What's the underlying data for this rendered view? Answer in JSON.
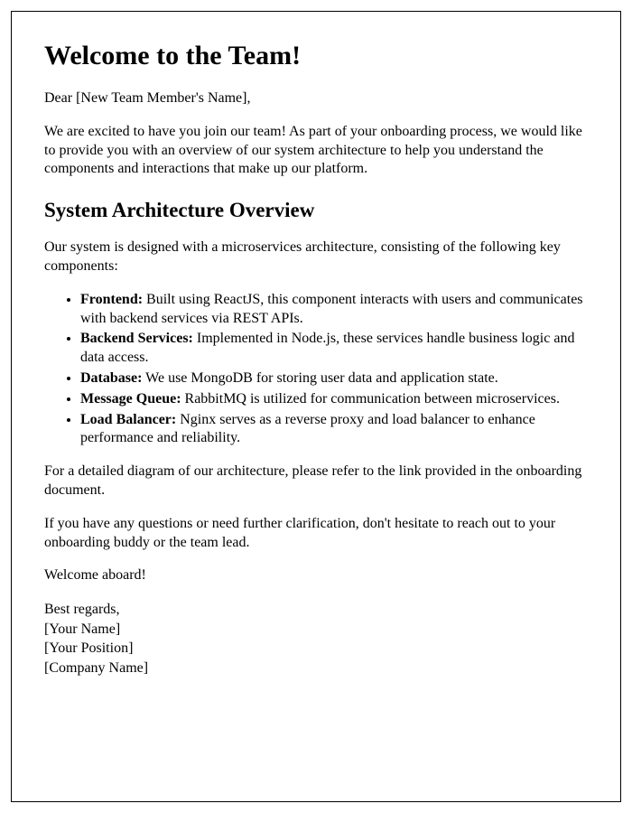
{
  "title": "Welcome to the Team!",
  "greeting": "Dear [New Team Member's Name],",
  "intro": "We are excited to have you join our team! As part of your onboarding process, we would like to provide you with an overview of our system architecture to help you understand the components and interactions that make up our platform.",
  "section_heading": "System Architecture Overview",
  "section_intro": "Our system is designed with a microservices architecture, consisting of the following key components:",
  "components": [
    {
      "label": "Frontend:",
      "desc": " Built using ReactJS, this component interacts with users and communicates with backend services via REST APIs."
    },
    {
      "label": "Backend Services:",
      "desc": " Implemented in Node.js, these services handle business logic and data access."
    },
    {
      "label": "Database:",
      "desc": " We use MongoDB for storing user data and application state."
    },
    {
      "label": "Message Queue:",
      "desc": " RabbitMQ is utilized for communication between microservices."
    },
    {
      "label": "Load Balancer:",
      "desc": " Nginx serves as a reverse proxy and load balancer to enhance performance and reliability."
    }
  ],
  "diagram_note": "For a detailed diagram of our architecture, please refer to the link provided in the onboarding document.",
  "questions_note": "If you have any questions or need further clarification, don't hesitate to reach out to your onboarding buddy or the team lead.",
  "welcome": "Welcome aboard!",
  "closing": "Best regards,",
  "sender_name": "[Your Name]",
  "sender_position": "[Your Position]",
  "company": "[Company Name]"
}
